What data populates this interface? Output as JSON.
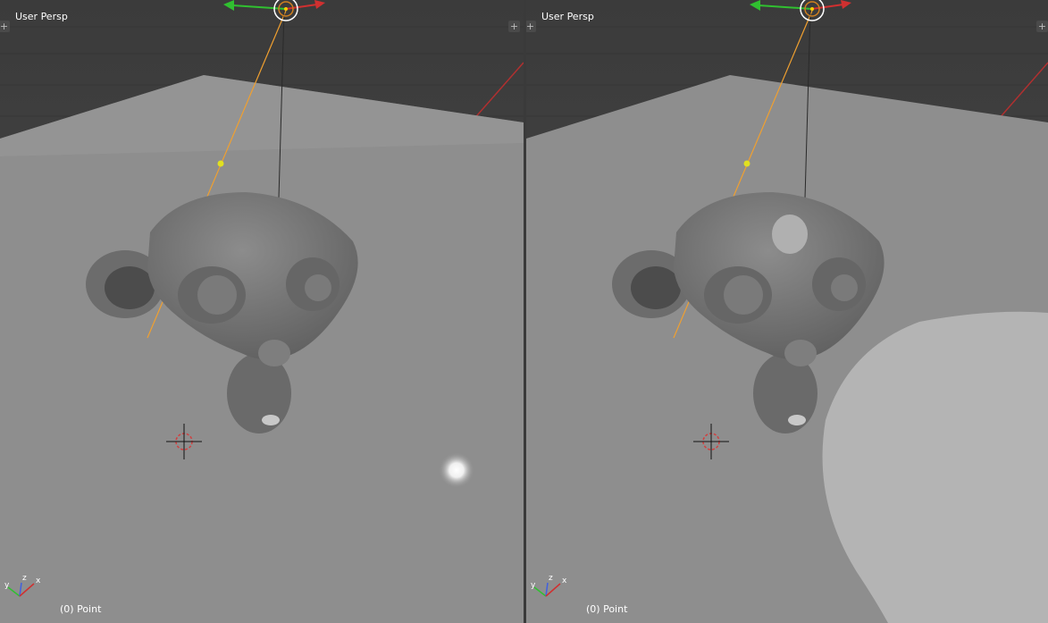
{
  "viewports": [
    {
      "view_label": "User Persp",
      "active_object_label": "(0) Point",
      "shading": "lamp-highlight",
      "widget_buttons": [
        "+",
        "+"
      ]
    },
    {
      "view_label": "User Persp",
      "active_object_label": "(0) Point",
      "shading": "large-bright-spot",
      "widget_buttons": [
        "+",
        "+"
      ]
    }
  ],
  "axis_labels": {
    "x": "x",
    "y": "y",
    "z": "z"
  },
  "colors": {
    "floor": "#8e8e8e",
    "background": "#3a3a3a",
    "lamp_line": "#f0a030",
    "lamp_point": "#e0e020",
    "x_axis": "#d03030",
    "y_axis": "#30c030",
    "z_axis": "#4060e0"
  }
}
